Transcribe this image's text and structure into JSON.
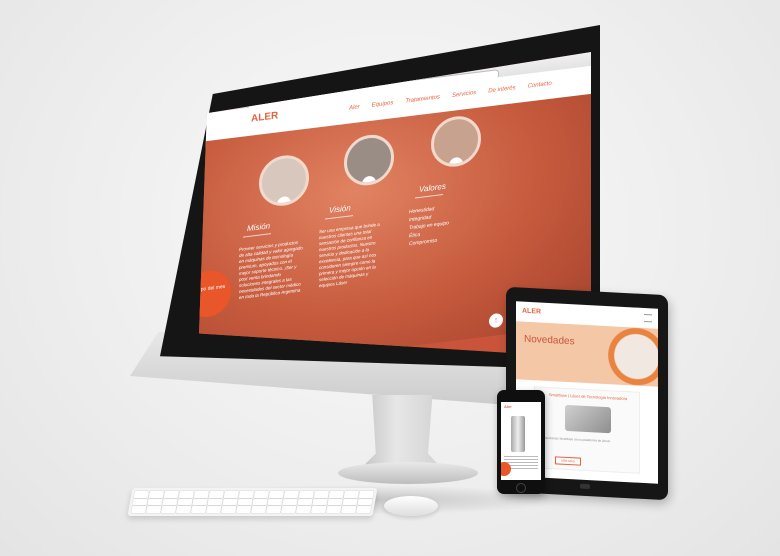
{
  "desktop": {
    "logo": "ALER",
    "nav": [
      "Aler",
      "Equipos",
      "Tratamientos",
      "Servicios",
      "De interés",
      "Contacto"
    ],
    "columns": [
      {
        "title": "Misión",
        "text": "Proveer servicios y productos de alta calidad y valor agregado en máquinas de tecnología premium, apoyados con el mejor soporte técnico. ¡Ser y post venta brindando soluciones integrales a las necesidades del sector médico en toda la República Argentina"
      },
      {
        "title": "Visión",
        "text": "Ser una empresa que brinde a nuestros clientes una total sensación de confianza en nuestros productos. Nuestro servicio y dedicación a la excelencia, para que así nos consideren siempre como la primera y mejor opción en la selección de máquinas y equipos Láser"
      },
      {
        "title": "Valores",
        "items": [
          "Honestidad",
          "Integridad",
          "Trabajo en equipo",
          "Ética",
          "Compromiso"
        ]
      }
    ],
    "badge": "Equipo del mes",
    "scroll_top": "↑"
  },
  "tablet": {
    "logo": "ALER",
    "hero_title": "Novedades",
    "card_title": "Smartlase | Láser de Tecnología Innovadora",
    "card_text": "Presentamos Smartlase con la plataforma de 20mm",
    "button": "VER MÁS"
  },
  "phone": {
    "logo": "Aler"
  },
  "colors": {
    "accent": "#e4663f",
    "hero": "#c65a3d"
  }
}
